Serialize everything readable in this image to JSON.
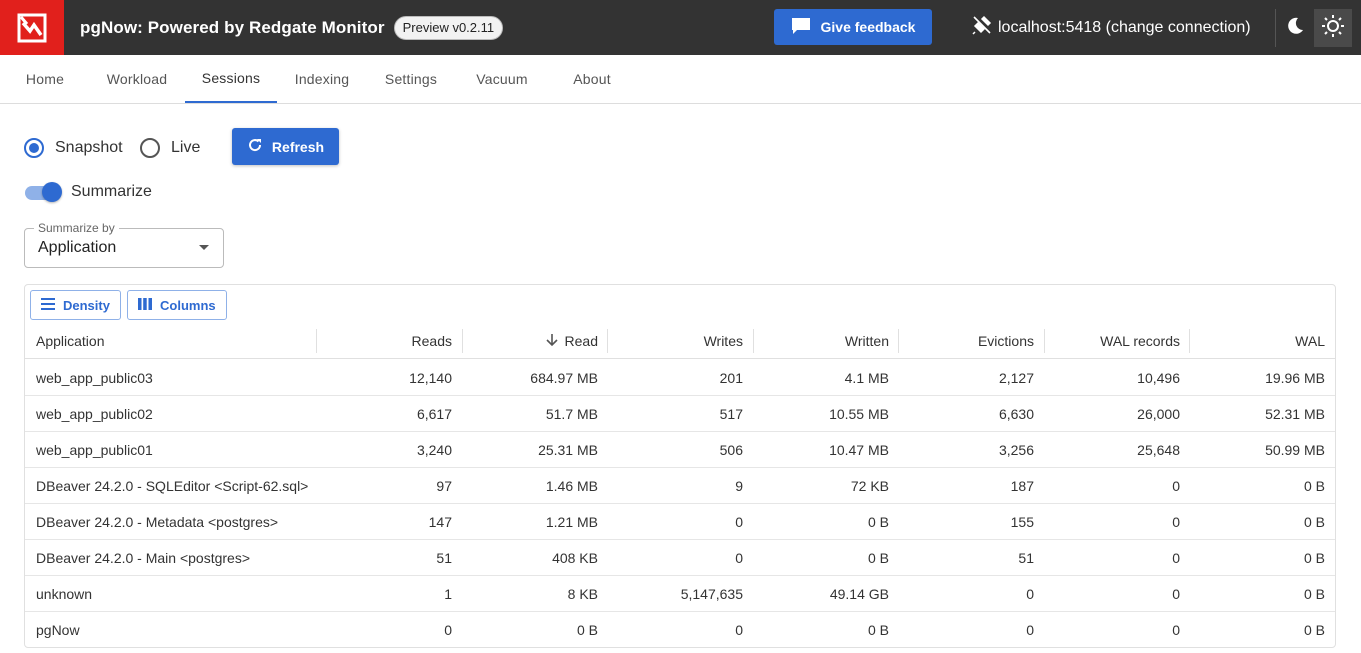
{
  "header": {
    "title": "pgNow: Powered by Redgate Monitor",
    "version": "Preview v0.2.11",
    "feedback_label": "Give feedback",
    "connection_label": "localhost:5418 (change connection)"
  },
  "tabs": [
    {
      "label": "Home",
      "active": false
    },
    {
      "label": "Workload",
      "active": false
    },
    {
      "label": "Sessions",
      "active": true
    },
    {
      "label": "Indexing",
      "active": false
    },
    {
      "label": "Settings",
      "active": false
    },
    {
      "label": "Vacuum",
      "active": false
    },
    {
      "label": "About",
      "active": false
    }
  ],
  "controls": {
    "snapshot_label": "Snapshot",
    "live_label": "Live",
    "mode_selected": "Snapshot",
    "refresh_label": "Refresh",
    "summarize_label": "Summarize",
    "summarize_on": true,
    "summarize_by_label": "Summarize by",
    "summarize_by_value": "Application"
  },
  "grid": {
    "density_label": "Density",
    "columns_label": "Columns",
    "columns": [
      "Application",
      "Reads",
      "Read",
      "Writes",
      "Written",
      "Evictions",
      "WAL records",
      "WAL"
    ],
    "sorted_column": "Read",
    "rows": [
      [
        "web_app_public03",
        "12,140",
        "684.97 MB",
        "201",
        "4.1 MB",
        "2,127",
        "10,496",
        "19.96 MB"
      ],
      [
        "web_app_public02",
        "6,617",
        "51.7 MB",
        "517",
        "10.55 MB",
        "6,630",
        "26,000",
        "52.31 MB"
      ],
      [
        "web_app_public01",
        "3,240",
        "25.31 MB",
        "506",
        "10.47 MB",
        "3,256",
        "25,648",
        "50.99 MB"
      ],
      [
        "DBeaver 24.2.0 - SQLEditor <Script-62.sql>",
        "97",
        "1.46 MB",
        "9",
        "72 KB",
        "187",
        "0",
        "0 B"
      ],
      [
        "DBeaver 24.2.0 - Metadata <postgres>",
        "147",
        "1.21 MB",
        "0",
        "0 B",
        "155",
        "0",
        "0 B"
      ],
      [
        "DBeaver 24.2.0 - Main <postgres>",
        "51",
        "408 KB",
        "0",
        "0 B",
        "51",
        "0",
        "0 B"
      ],
      [
        "unknown",
        "1",
        "8 KB",
        "5,147,635",
        "49.14 GB",
        "0",
        "0",
        "0 B"
      ],
      [
        "pgNow",
        "0",
        "0 B",
        "0",
        "0 B",
        "0",
        "0",
        "0 B"
      ]
    ]
  },
  "icons": {
    "feedback": "chat-bubble-icon",
    "connection": "plug-icon",
    "dark_mode": "moon-icon",
    "light_mode": "sun-icon",
    "refresh": "refresh-icon",
    "density": "density-icon",
    "columns": "columns-icon",
    "sort": "arrow-down-icon"
  },
  "colors": {
    "accent": "#2e6ad1",
    "brand": "#e1201c",
    "appbar": "#333333"
  }
}
